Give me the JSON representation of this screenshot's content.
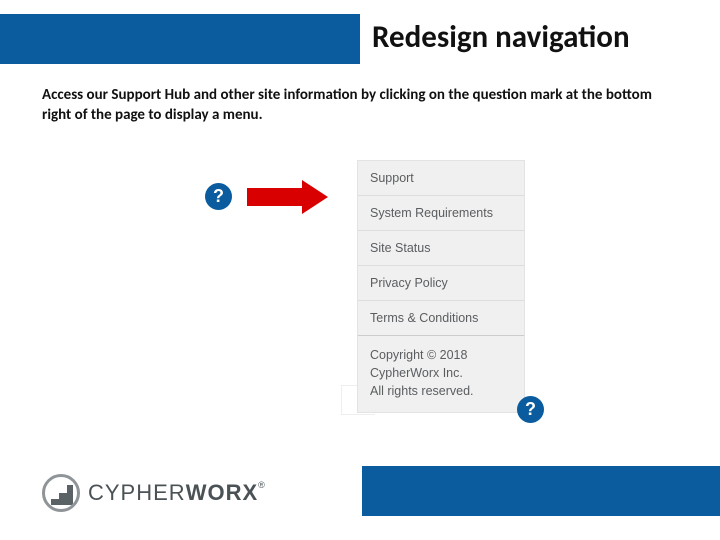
{
  "title": "Redesign navigation",
  "description": "Access our Support Hub and other site information by clicking on the question mark at the bottom right of the page to display a menu.",
  "help_symbol": "?",
  "menu": {
    "items": [
      "Support",
      "System Requirements",
      "Site Status",
      "Privacy Policy",
      "Terms & Conditions"
    ],
    "copyright_line1": "Copyright © 2018",
    "copyright_line2": "CypherWorx Inc.",
    "copyright_line3": "All rights reserved."
  },
  "logo": {
    "part1": "CYPHER",
    "part2": "WORX",
    "trademark": "®"
  }
}
